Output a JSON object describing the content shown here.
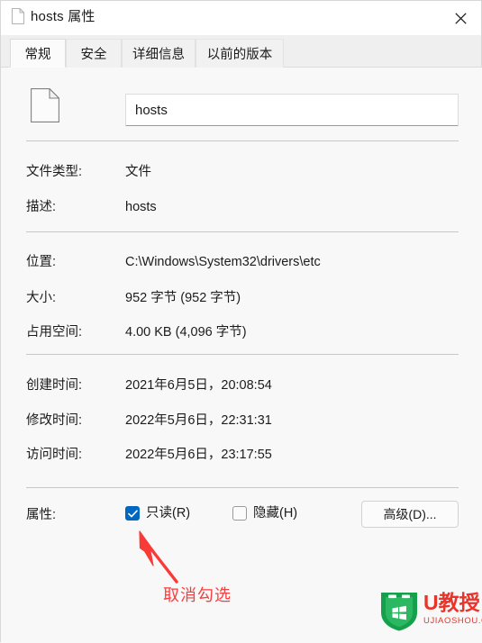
{
  "window": {
    "title": "hosts 属性",
    "title_icon": "file-icon",
    "close_label": "✕"
  },
  "tabs": [
    {
      "label": "常规",
      "active": true
    },
    {
      "label": "安全",
      "active": false
    },
    {
      "label": "详细信息",
      "active": false
    },
    {
      "label": "以前的版本",
      "active": false
    }
  ],
  "general": {
    "file_icon": "file-icon",
    "filename_value": "hosts",
    "filename_placeholder": "",
    "rows": [
      {
        "label": "文件类型:",
        "value": "文件"
      },
      {
        "label": "描述:",
        "value": "hosts"
      },
      {
        "label": "位置:",
        "value": "C:\\Windows\\System32\\drivers\\etc"
      },
      {
        "label": "大小:",
        "value": "952 字节 (952 字节)"
      },
      {
        "label": "占用空间:",
        "value": "4.00 KB (4,096 字节)"
      },
      {
        "label": "创建时间:",
        "value": "2021年6月5日，20:08:54"
      },
      {
        "label": "修改时间:",
        "value": "2022年5月6日，22:31:31"
      },
      {
        "label": "访问时间:",
        "value": "2022年5月6日，23:17:55"
      }
    ],
    "attributes": {
      "label": "属性:",
      "readonly_label": "只读(R)",
      "readonly_checked": true,
      "hidden_label": "隐藏(H)",
      "hidden_checked": false,
      "advanced_label": "高级(D)..."
    }
  },
  "annotation": {
    "text": "取消勾选",
    "color": "#fa3c3c"
  },
  "watermark": {
    "name": "U教授",
    "domain": "UJIAOSHOU.COM",
    "color": "#e8352c",
    "shield_color": "#16a04a"
  }
}
